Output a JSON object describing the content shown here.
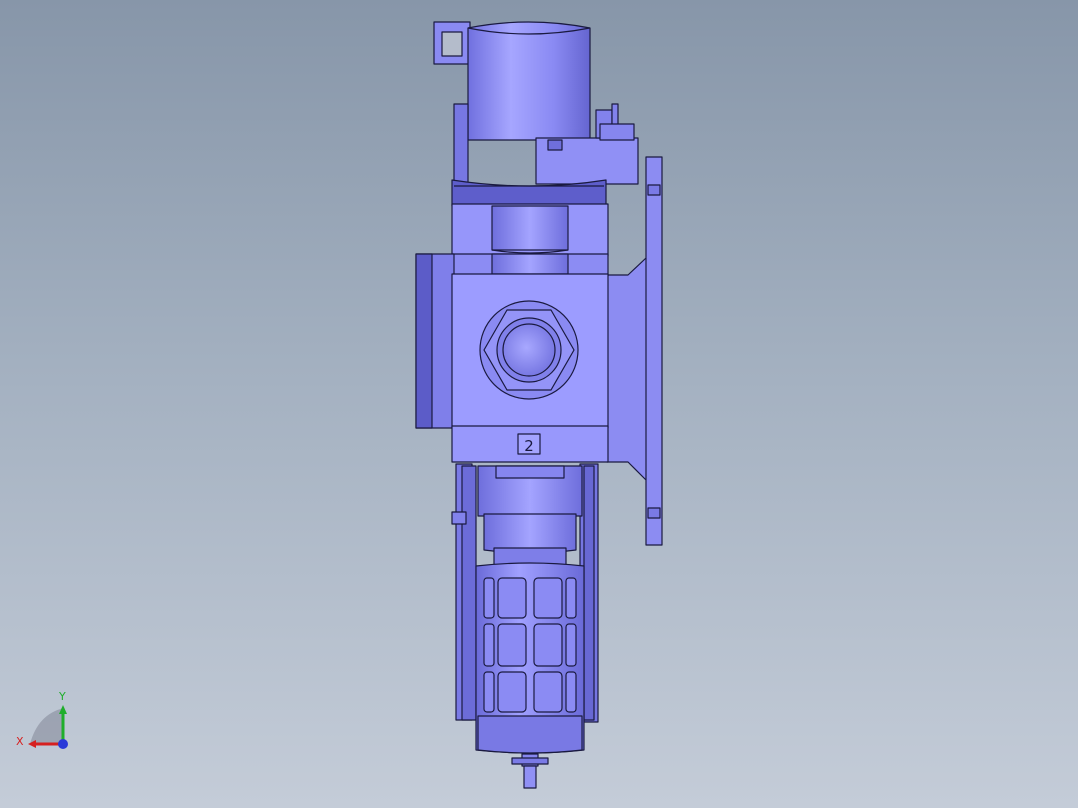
{
  "model": {
    "port_marking": "2",
    "colors": {
      "face": "#8e8ef5",
      "face_light": "#a2a2ff",
      "face_mid": "#7d7de8",
      "face_dark": "#6767d2",
      "face_darker": "#5353bf",
      "edge": "#1a1a40",
      "background_top": "#8796a9",
      "background_bottom": "#c4ccd8"
    }
  },
  "triad": {
    "x_label": "X",
    "y_label": "Y",
    "x_color": "#d62020",
    "y_color": "#1fae2b",
    "z_color": "#2a39d8"
  }
}
